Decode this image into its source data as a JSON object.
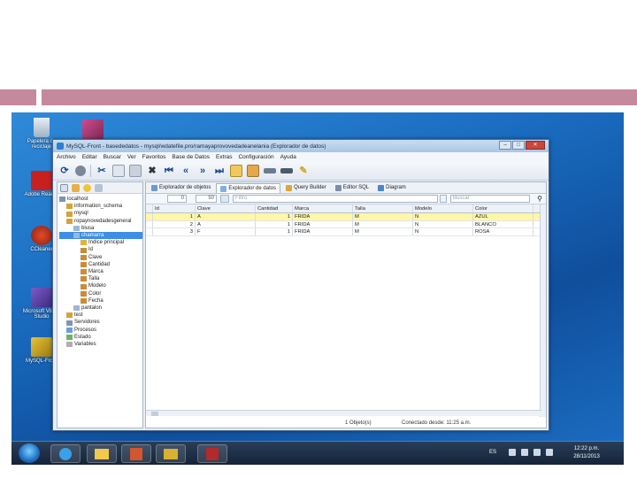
{
  "window": {
    "title": "MySQL-Front - basededatos - mysql/wdatefile.pro/ramayaprovovedadeanelania (Explorador de datos)",
    "menu": [
      "Archivo",
      "Editar",
      "Buscar",
      "Ver",
      "Favoritos",
      "Base de Datos",
      "Extras",
      "Configuración",
      "Ayuda"
    ],
    "controls": {
      "minimize": "–",
      "maximize": "□",
      "close": "✕"
    }
  },
  "desktop_icons": [
    {
      "label": "Papelera de reciclaje",
      "icon": "recycle-bin-icon"
    },
    {
      "label": "Adobe Reader",
      "icon": "adobe-reader-icon"
    },
    {
      "label": "CCleaner",
      "icon": "ccleaner-icon"
    },
    {
      "label": "Microsoft Visual Studio",
      "icon": "visual-studio-icon"
    },
    {
      "label": "MySQL-Front",
      "icon": "mysql-front-icon"
    }
  ],
  "toolbar_icons": [
    "refresh-icon",
    "stop-icon",
    "cut-icon",
    "copy-icon",
    "paste-icon",
    "delete-icon",
    "first-icon",
    "prev-icon",
    "next-icon",
    "last-icon",
    "grid-icon",
    "form-icon",
    "insert-row-icon",
    "delete-row-icon",
    "clear-icon"
  ],
  "tree": [
    {
      "label": "localhost",
      "indent": 0,
      "icon": "server-icon"
    },
    {
      "label": "information_schema",
      "indent": 1,
      "icon": "database-icon"
    },
    {
      "label": "mysql",
      "indent": 1,
      "icon": "database-icon"
    },
    {
      "label": "ropaynovedadesgeneral",
      "indent": 1,
      "icon": "database-icon"
    },
    {
      "label": "blusa",
      "indent": 2,
      "icon": "table-icon"
    },
    {
      "label": "chamarra",
      "indent": 2,
      "icon": "table-icon",
      "selected": true
    },
    {
      "label": "Indice principal",
      "indent": 3,
      "icon": "key-icon"
    },
    {
      "label": "Id",
      "indent": 3,
      "icon": "field-icon"
    },
    {
      "label": "Clave",
      "indent": 3,
      "icon": "field-icon"
    },
    {
      "label": "Cantidad",
      "indent": 3,
      "icon": "field-icon"
    },
    {
      "label": "Marca",
      "indent": 3,
      "icon": "field-icon"
    },
    {
      "label": "Talla",
      "indent": 3,
      "icon": "field-icon"
    },
    {
      "label": "Modelo",
      "indent": 3,
      "icon": "field-icon"
    },
    {
      "label": "Color",
      "indent": 3,
      "icon": "field-icon"
    },
    {
      "label": "Fecha",
      "indent": 3,
      "icon": "field-icon"
    },
    {
      "label": "pantalon",
      "indent": 2,
      "icon": "table-icon"
    },
    {
      "label": "test",
      "indent": 1,
      "icon": "database-icon"
    },
    {
      "label": "Servidores",
      "indent": 1,
      "icon": "server-icon"
    },
    {
      "label": "Procesos",
      "indent": 1,
      "icon": "process-icon"
    },
    {
      "label": "Estado",
      "indent": 1,
      "icon": "status-icon"
    },
    {
      "label": "Variables",
      "indent": 1,
      "icon": "variables-icon"
    }
  ],
  "tabs": [
    {
      "label": "Explorador de objetos",
      "active": false
    },
    {
      "label": "Explorador de datos",
      "active": true
    },
    {
      "label": "Query Builder",
      "active": false
    },
    {
      "label": "Editor SQL",
      "active": false
    },
    {
      "label": "Diagram",
      "active": false
    }
  ],
  "filterbar": {
    "offset": "0",
    "limit": "50",
    "filter_placeholder": "Filtro",
    "search_placeholder": "Buscar"
  },
  "grid": {
    "columns": [
      "Id",
      "Clave",
      "Cantidad",
      "Marca",
      "Talla",
      "Modelo",
      "Color"
    ],
    "rows": [
      [
        "1",
        "A",
        "1",
        "FRIDA",
        "M",
        "N",
        "AZUL"
      ],
      [
        "2",
        "A",
        "1",
        "FRIDA",
        "M",
        "N",
        "BLANCO"
      ],
      [
        "3",
        "F",
        "1",
        "FRIDA",
        "M",
        "N",
        "ROSA"
      ]
    ],
    "selected_row": 0
  },
  "status": {
    "objects": "1 Objeto(s)",
    "connection": "Conectado desde: 11:25 a.m."
  },
  "taskbar": {
    "apps": [
      "explorer",
      "powerpoint",
      "mysql-front",
      "access"
    ],
    "lang": "ES",
    "time": "12:22 p.m.",
    "date": "28/11/2013"
  },
  "colors": {
    "slide_bar": "#c4899c",
    "selected_row": "#fff7a8",
    "tree_selection": "#3d8ee6"
  }
}
